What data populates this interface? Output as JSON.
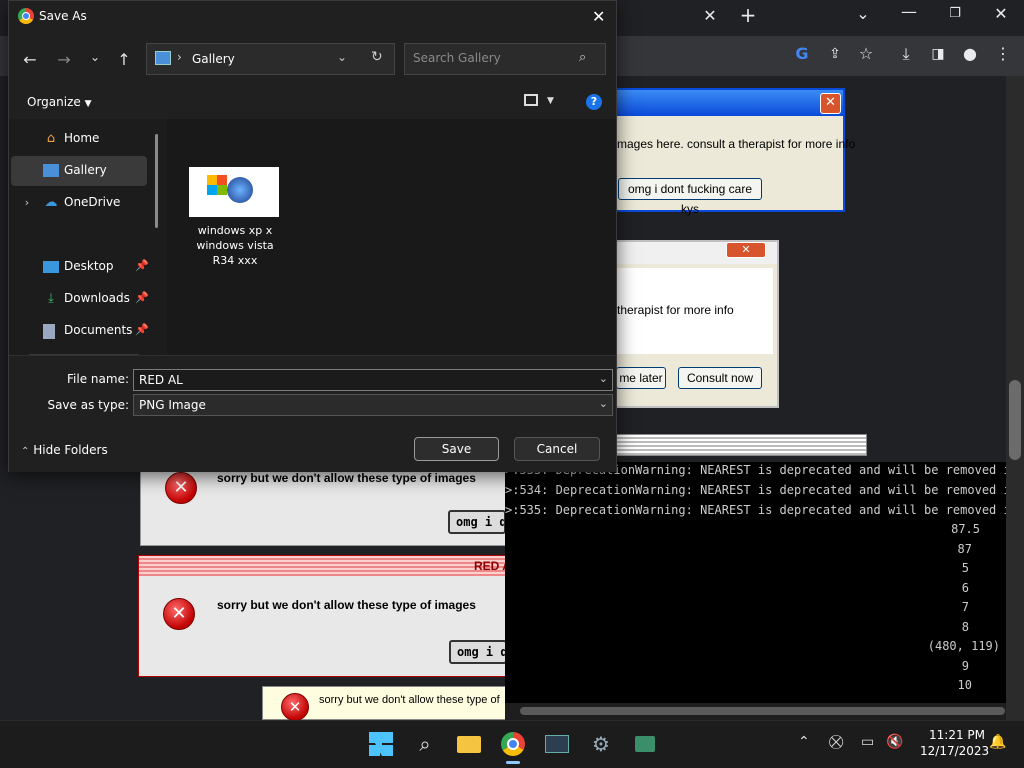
{
  "dialog": {
    "title": "Save As",
    "address_location": "Gallery",
    "search_placeholder": "Search Gallery",
    "organize_label": "Organize",
    "nav": {
      "home": "Home",
      "gallery": "Gallery",
      "onedrive": "OneDrive",
      "desktop": "Desktop",
      "downloads": "Downloads",
      "documents": "Documents"
    },
    "file_item_caption": "windows xp x windows vista R34 xxx",
    "file_name_label": "File name:",
    "file_name_value": "RED AL",
    "save_type_label": "Save as type:",
    "save_type_value": "PNG Image",
    "hide_folders_label": "Hide Folders",
    "save_button": "Save",
    "cancel_button": "Cancel"
  },
  "popup1": {
    "message": "mages here. consult a therapist for more info",
    "button": "omg i dont fucking care kys"
  },
  "popup2": {
    "message": "therapist for more info",
    "later_button": "me later",
    "consult_button": "Consult now"
  },
  "error1": {
    "message": "sorry but we don't allow these type of images",
    "button": "omg i do"
  },
  "error2": {
    "title": "RED A",
    "message": "sorry but we don't allow these type of images",
    "button": "omg i de"
  },
  "error3": {
    "message": "sorry but we don't allow these type of"
  },
  "terminal": {
    "lines": [
      ">:533: DeprecationWarning: NEAREST is deprecated and will be removed in",
      ">:534: DeprecationWarning: NEAREST is deprecated and will be removed in",
      ">:535: DeprecationWarning: NEAREST is deprecated and will be removed in"
    ],
    "outputs": [
      "87.5",
      "87",
      "5",
      "6",
      "7",
      "8",
      "(480, 119)",
      "9",
      "10"
    ]
  },
  "taskbar": {
    "time": "11:21 PM",
    "date": "12/17/2023"
  },
  "colors": {
    "xp_blue": "#0a4ad8",
    "error_red": "#c00000",
    "dialog_bg": "#202020",
    "taskbar_bg": "#1c1c1c"
  }
}
